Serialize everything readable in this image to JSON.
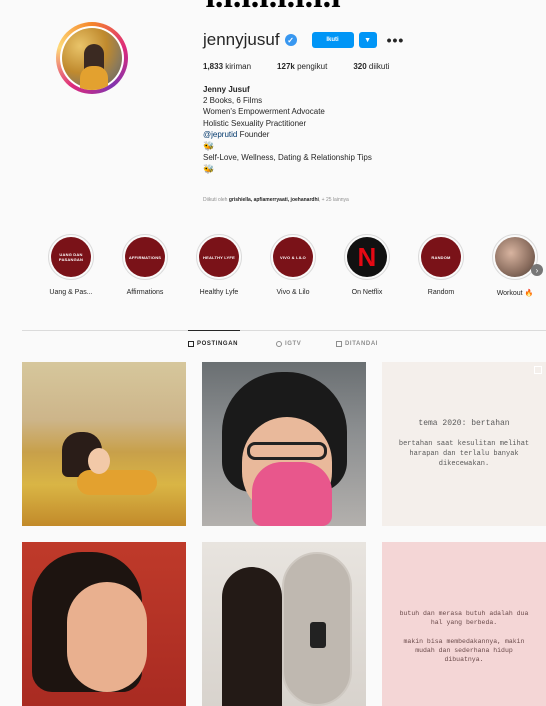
{
  "page": {
    "title_fragment": "ı.ı.ı.ı.ı.ı.ı.ı"
  },
  "profile": {
    "username": "jennyjusuf",
    "follow_label": "Ikuti",
    "more_label": "•••",
    "stats": {
      "posts_count": "1,833",
      "posts_label": "kiriman",
      "followers_count": "127k",
      "followers_label": "pengikut",
      "following_count": "320",
      "following_label": "diikuti"
    },
    "bio": {
      "name": "Jenny Jusuf",
      "line1": "2 Books, 6 Films",
      "line2": "Women's Empowerment Advocate",
      "line3": "Holistic Sexuality Practitioner",
      "link": "@jeprutid",
      "link_suffix": " Founder",
      "emoji1": "🐝",
      "line4": "Self-Love, Wellness, Dating & Relationship Tips",
      "emoji2": "🐝"
    },
    "followed_by_prefix": "Diikuti oleh ",
    "followed_by_names": "grishiella, apfiamerryaati, joehanardhi",
    "followed_by_suffix": ", + 25 lainnya"
  },
  "highlights": [
    {
      "label": "Uang & Pas...",
      "cover_text": "UANG DAN PASANGAN"
    },
    {
      "label": "Affirmations",
      "cover_text": "AFFIRMATIONS"
    },
    {
      "label": "Healthy Lyfe",
      "cover_text": "HEALTHY LYFE"
    },
    {
      "label": "Vivo & Lilo",
      "cover_text": "VIVO & LILO"
    },
    {
      "label": "On Netflix",
      "cover_text": "N"
    },
    {
      "label": "Random",
      "cover_text": "RANDOM"
    },
    {
      "label": "Workout 🔥",
      "cover_text": ""
    }
  ],
  "tabs": [
    {
      "label": "POSTINGAN",
      "active": true
    },
    {
      "label": "IGTV",
      "active": false
    },
    {
      "label": "DITANDAI",
      "active": false
    }
  ],
  "posts": {
    "p3_title": "tema 2020: bertahan",
    "p3_body": "bertahan saat kesulitan melihat harapan dan terlalu banyak dikecewakan.",
    "p6_line1": "butuh dan merasa butuh adalah dua hal yang berbeda.",
    "p6_line2": "makin bisa membedakannya, makin mudah dan sederhana hidup dibuatnya."
  },
  "colors": {
    "accent": "#0095f6",
    "highlight_bg": "#7a1218",
    "netflix_red": "#e50914"
  },
  "icons": {
    "verified": "verified-badge-icon",
    "dropdown": "chevron-down-icon",
    "next": "chevron-right-icon"
  }
}
